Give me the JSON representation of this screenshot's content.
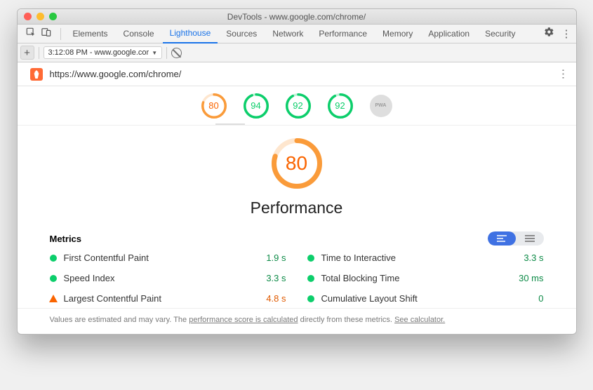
{
  "window": {
    "title": "DevTools - www.google.com/chrome/"
  },
  "tabs": {
    "items": [
      "Elements",
      "Console",
      "Lighthouse",
      "Sources",
      "Network",
      "Performance",
      "Memory",
      "Application",
      "Security"
    ],
    "activeIndex": 2
  },
  "subtoolbar": {
    "timestamp": "3:12:08 PM - www.google.cor"
  },
  "address": {
    "url": "https://www.google.com/chrome/"
  },
  "gauges": [
    {
      "value": "80",
      "pct": 80,
      "color": "orange"
    },
    {
      "value": "94",
      "pct": 94,
      "color": "green"
    },
    {
      "value": "92",
      "pct": 92,
      "color": "green"
    },
    {
      "value": "92",
      "pct": 92,
      "color": "green"
    }
  ],
  "pwaBadge": "PWA",
  "hero": {
    "value": "80",
    "pct": 80,
    "title": "Performance"
  },
  "metrics": {
    "heading": "Metrics",
    "left": [
      {
        "ind": "green",
        "label": "First Contentful Paint",
        "value": "1.9 s",
        "vclass": "green"
      },
      {
        "ind": "green",
        "label": "Speed Index",
        "value": "3.3 s",
        "vclass": "green"
      },
      {
        "ind": "orange",
        "label": "Largest Contentful Paint",
        "value": "4.8 s",
        "vclass": "orange"
      }
    ],
    "right": [
      {
        "ind": "green",
        "label": "Time to Interactive",
        "value": "3.3 s",
        "vclass": "green"
      },
      {
        "ind": "green",
        "label": "Total Blocking Time",
        "value": "30 ms",
        "vclass": "green"
      },
      {
        "ind": "green",
        "label": "Cumulative Layout Shift",
        "value": "0",
        "vclass": "green"
      }
    ]
  },
  "footnote": {
    "pre": "Values are estimated and may vary. The ",
    "link1": "performance score is calculated",
    "mid": " directly from these metrics. ",
    "link2": "See calculator."
  }
}
